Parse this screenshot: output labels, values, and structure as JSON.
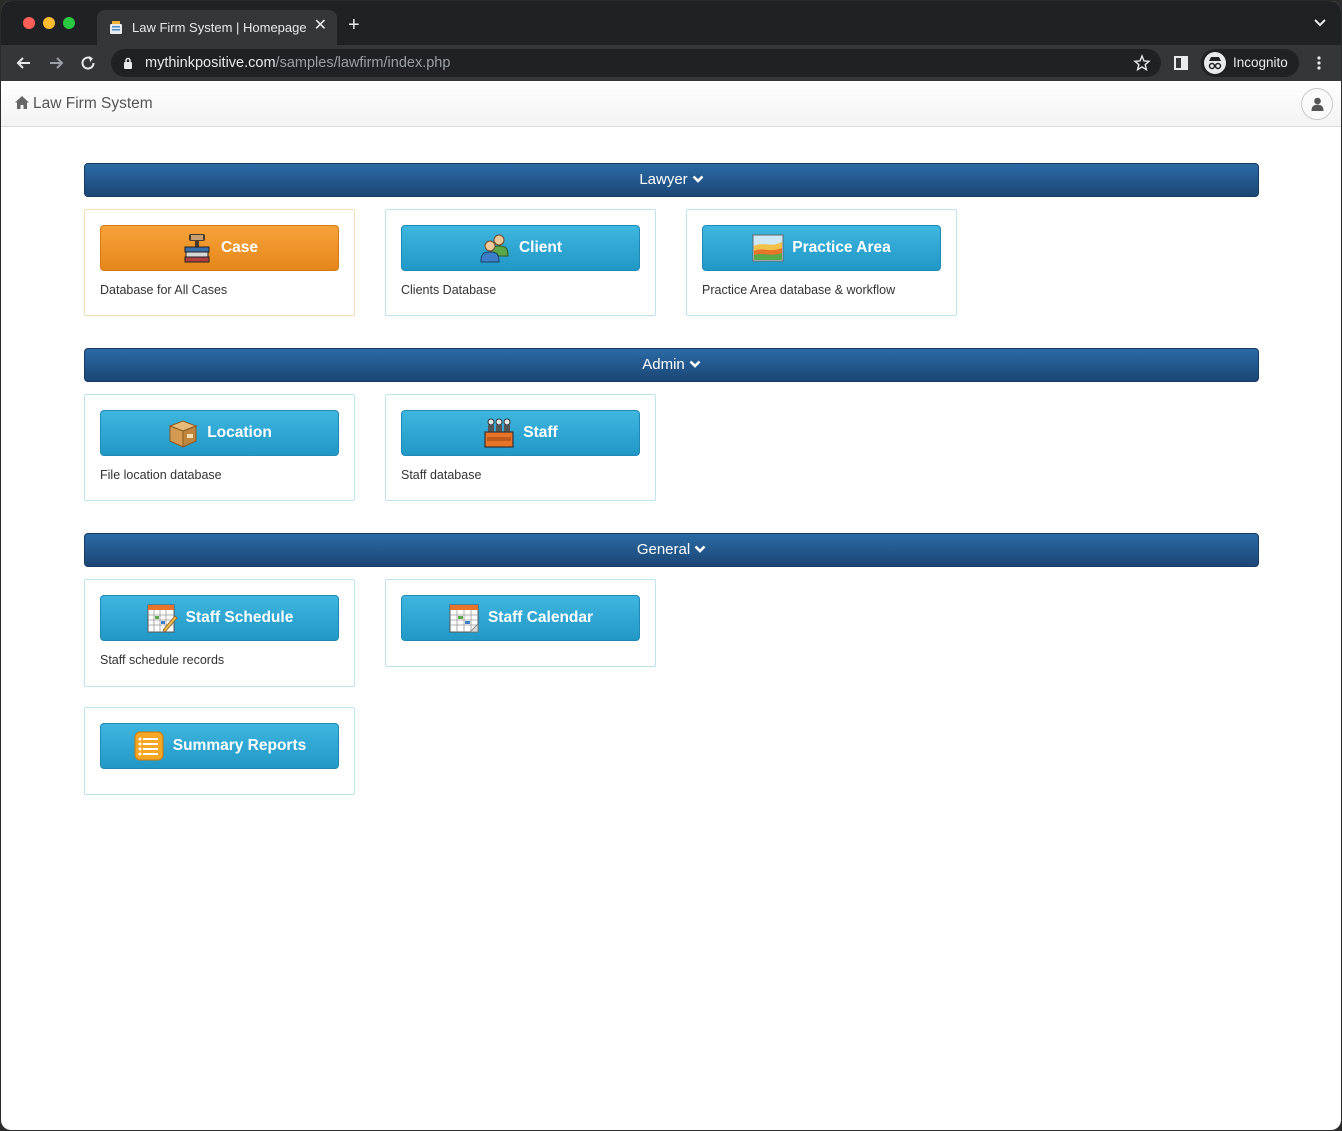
{
  "browser": {
    "tab_title": "Law Firm System | Homepage",
    "url_host": "mythinkpositive.com",
    "url_path": "/samples/lawfirm/index.php",
    "profile_label": "Incognito"
  },
  "navbar": {
    "brand": "Law Firm System",
    "home_icon": "home-icon",
    "user_icon": "user-icon"
  },
  "sections": [
    {
      "title": "Lawyer",
      "cards": [
        {
          "label": "Case",
          "description": "Database for All Cases",
          "icon": "gavel-books-icon",
          "color": "#e6861a"
        },
        {
          "label": "Client",
          "description": "Clients Database",
          "icon": "clients-icon",
          "color": "#2198c6"
        },
        {
          "label": "Practice Area",
          "description": "Practice Area database & workflow",
          "icon": "area-chart-icon",
          "color": "#2198c6"
        }
      ]
    },
    {
      "title": "Admin",
      "cards": [
        {
          "label": "Location",
          "description": "File location database",
          "icon": "box-icon",
          "color": "#2198c6"
        },
        {
          "label": "Staff",
          "description": "Staff database",
          "icon": "staff-group-icon",
          "color": "#2198c6"
        }
      ]
    },
    {
      "title": "General",
      "cards": [
        {
          "label": "Staff Schedule",
          "description": "Staff schedule records",
          "icon": "schedule-icon",
          "color": "#2198c6"
        },
        {
          "label": "Staff Calendar",
          "description": "",
          "icon": "calendar-icon",
          "color": "#2198c6"
        },
        {
          "label": "Summary Reports",
          "description": "",
          "icon": "report-list-icon",
          "color": "#2198c6"
        }
      ]
    }
  ],
  "colors": {
    "header_blue": "#1b4675",
    "button_blue": "#2198c6",
    "button_orange": "#e6861a"
  }
}
